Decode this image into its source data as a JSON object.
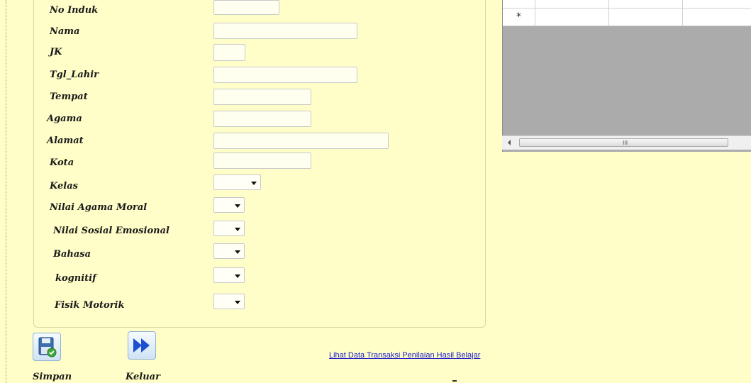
{
  "form": {
    "labels": {
      "no_induk": "No Induk",
      "nama": "Nama",
      "jk": "JK",
      "tgl_lahir": "Tgl_Lahir",
      "tempat": "Tempat",
      "agama": "Agama",
      "alamat": "Alamat",
      "kota": "Kota",
      "kelas": "Kelas",
      "nilai_agama_moral": "Nilai Agama Moral",
      "nilai_sosial_emosional": "Nilai Sosial Emosional",
      "bahasa": "Bahasa",
      "kognitif": "kognitif",
      "fisik_motorik": "Fisik Motorik"
    },
    "values": {
      "no_induk": "",
      "nama": "",
      "jk": "",
      "tgl_lahir": "",
      "tempat": "",
      "agama": "",
      "alamat": "",
      "kota": "",
      "kelas": "",
      "nilai_agama_moral": "",
      "nilai_sosial_emosional": "",
      "bahasa": "",
      "kognitif": "",
      "fisik_motorik": ""
    }
  },
  "grid": {
    "new_row_marker": "*",
    "scrollbar_grip": "III"
  },
  "actions": {
    "simpan_label": "Simpan",
    "keluar_label": "Keluar",
    "link_text": "Lihat Data Transaksi Penilaian Hasil Belajar"
  },
  "icons": {
    "save": "floppy-save-icon",
    "exit": "fast-forward-icon"
  },
  "colors": {
    "background": "#fffec8",
    "link": "#1a1ac8",
    "grid_background": "#ababab"
  }
}
